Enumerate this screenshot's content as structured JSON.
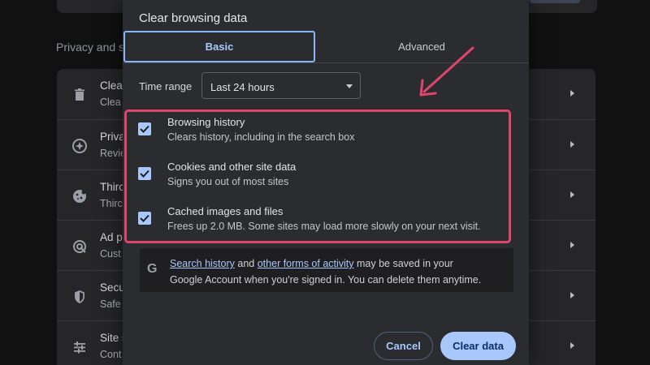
{
  "background": {
    "section_title": "Privacy and s",
    "rows": [
      {
        "icon": "trash-icon",
        "title": "Clea",
        "sub": "Clea"
      },
      {
        "icon": "compass-icon",
        "title": "Priva",
        "sub": "Revie"
      },
      {
        "icon": "cookie-icon",
        "title": "Thirc",
        "sub": "Thirc"
      },
      {
        "icon": "ad-icon",
        "title": "Ad p",
        "sub": "Cust"
      },
      {
        "icon": "shield-icon",
        "title": "Secu",
        "sub": "Safe"
      },
      {
        "icon": "sliders-icon",
        "title": "Site s",
        "sub": "Cont"
      }
    ]
  },
  "dialog": {
    "title": "Clear browsing data",
    "tabs": {
      "basic": "Basic",
      "advanced": "Advanced"
    },
    "time_range": {
      "label": "Time range",
      "value": "Last 24 hours"
    },
    "items": [
      {
        "label": "Browsing history",
        "sub": "Clears history, including in the search box",
        "checked": true
      },
      {
        "label": "Cookies and other site data",
        "sub": "Signs you out of most sites",
        "checked": true
      },
      {
        "label": "Cached images and files",
        "sub": "Frees up 2.0 MB. Some sites may load more slowly on your next visit.",
        "checked": true
      }
    ],
    "info": {
      "link1": "Search history",
      "and": "and",
      "link2": "other forms of activity",
      "rest1": "may be saved in your",
      "rest2": "Google Account when you're signed in. You can delete them anytime."
    },
    "buttons": {
      "cancel": "Cancel",
      "clear": "Clear data"
    }
  },
  "colors": {
    "accent": "#a8c7fa",
    "highlight": "#e0456b",
    "dialog_bg": "#2b2c30"
  }
}
